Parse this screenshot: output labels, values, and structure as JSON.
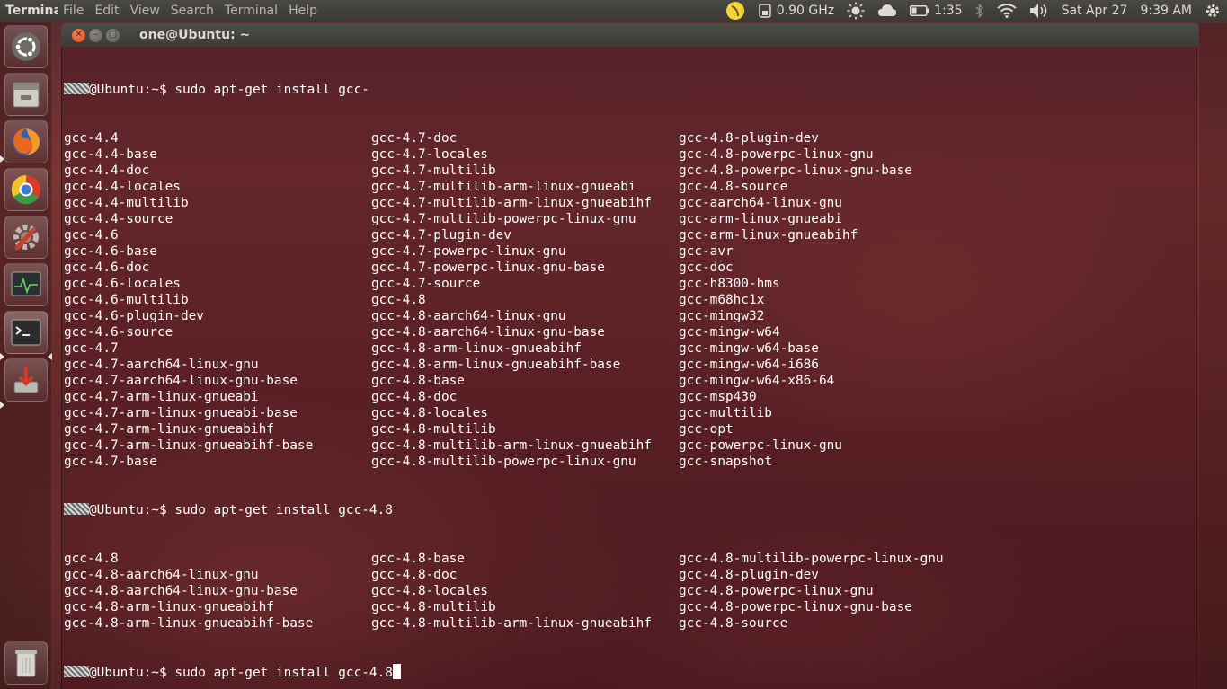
{
  "top_panel": {
    "app_name": "Terminal",
    "menus": [
      "File",
      "Edit",
      "View",
      "Search",
      "Terminal",
      "Help"
    ],
    "cpu_freq": "0.90 GHz",
    "battery_time": "1:35",
    "date": "Sat Apr 27",
    "time": "9:39 AM"
  },
  "launcher": {
    "items": [
      "ubuntu-dash",
      "files",
      "firefox",
      "chrome",
      "system-settings",
      "system-monitor",
      "terminal",
      "update-manager",
      "trash"
    ]
  },
  "window": {
    "title": "one@Ubuntu: ~"
  },
  "terminal": {
    "prompt": "@Ubuntu:~$ ",
    "commands": [
      "sudo apt-get install gcc-",
      "sudo apt-get install gcc-4.8",
      "sudo apt-get install gcc-4.8"
    ],
    "block1": [
      [
        "gcc-4.4",
        "gcc-4.7-doc",
        "gcc-4.8-plugin-dev"
      ],
      [
        "gcc-4.4-base",
        "gcc-4.7-locales",
        "gcc-4.8-powerpc-linux-gnu"
      ],
      [
        "gcc-4.4-doc",
        "gcc-4.7-multilib",
        "gcc-4.8-powerpc-linux-gnu-base"
      ],
      [
        "gcc-4.4-locales",
        "gcc-4.7-multilib-arm-linux-gnueabi",
        "gcc-4.8-source"
      ],
      [
        "gcc-4.4-multilib",
        "gcc-4.7-multilib-arm-linux-gnueabihf",
        "gcc-aarch64-linux-gnu"
      ],
      [
        "gcc-4.4-source",
        "gcc-4.7-multilib-powerpc-linux-gnu",
        "gcc-arm-linux-gnueabi"
      ],
      [
        "gcc-4.6",
        "gcc-4.7-plugin-dev",
        "gcc-arm-linux-gnueabihf"
      ],
      [
        "gcc-4.6-base",
        "gcc-4.7-powerpc-linux-gnu",
        "gcc-avr"
      ],
      [
        "gcc-4.6-doc",
        "gcc-4.7-powerpc-linux-gnu-base",
        "gcc-doc"
      ],
      [
        "gcc-4.6-locales",
        "gcc-4.7-source",
        "gcc-h8300-hms"
      ],
      [
        "gcc-4.6-multilib",
        "gcc-4.8",
        "gcc-m68hc1x"
      ],
      [
        "gcc-4.6-plugin-dev",
        "gcc-4.8-aarch64-linux-gnu",
        "gcc-mingw32"
      ],
      [
        "gcc-4.6-source",
        "gcc-4.8-aarch64-linux-gnu-base",
        "gcc-mingw-w64"
      ],
      [
        "gcc-4.7",
        "gcc-4.8-arm-linux-gnueabihf",
        "gcc-mingw-w64-base"
      ],
      [
        "gcc-4.7-aarch64-linux-gnu",
        "gcc-4.8-arm-linux-gnueabihf-base",
        "gcc-mingw-w64-i686"
      ],
      [
        "gcc-4.7-aarch64-linux-gnu-base",
        "gcc-4.8-base",
        "gcc-mingw-w64-x86-64"
      ],
      [
        "gcc-4.7-arm-linux-gnueabi",
        "gcc-4.8-doc",
        "gcc-msp430"
      ],
      [
        "gcc-4.7-arm-linux-gnueabi-base",
        "gcc-4.8-locales",
        "gcc-multilib"
      ],
      [
        "gcc-4.7-arm-linux-gnueabihf",
        "gcc-4.8-multilib",
        "gcc-opt"
      ],
      [
        "gcc-4.7-arm-linux-gnueabihf-base",
        "gcc-4.8-multilib-arm-linux-gnueabihf",
        "gcc-powerpc-linux-gnu"
      ],
      [
        "gcc-4.7-base",
        "gcc-4.8-multilib-powerpc-linux-gnu",
        "gcc-snapshot"
      ]
    ],
    "block2": [
      [
        "gcc-4.8",
        "gcc-4.8-base",
        "gcc-4.8-multilib-powerpc-linux-gnu"
      ],
      [
        "gcc-4.8-aarch64-linux-gnu",
        "gcc-4.8-doc",
        "gcc-4.8-plugin-dev"
      ],
      [
        "gcc-4.8-aarch64-linux-gnu-base",
        "gcc-4.8-locales",
        "gcc-4.8-powerpc-linux-gnu"
      ],
      [
        "gcc-4.8-arm-linux-gnueabihf",
        "gcc-4.8-multilib",
        "gcc-4.8-powerpc-linux-gnu-base"
      ],
      [
        "gcc-4.8-arm-linux-gnueabihf-base",
        "gcc-4.8-multilib-arm-linux-gnueabihf",
        "gcc-4.8-source"
      ]
    ]
  }
}
